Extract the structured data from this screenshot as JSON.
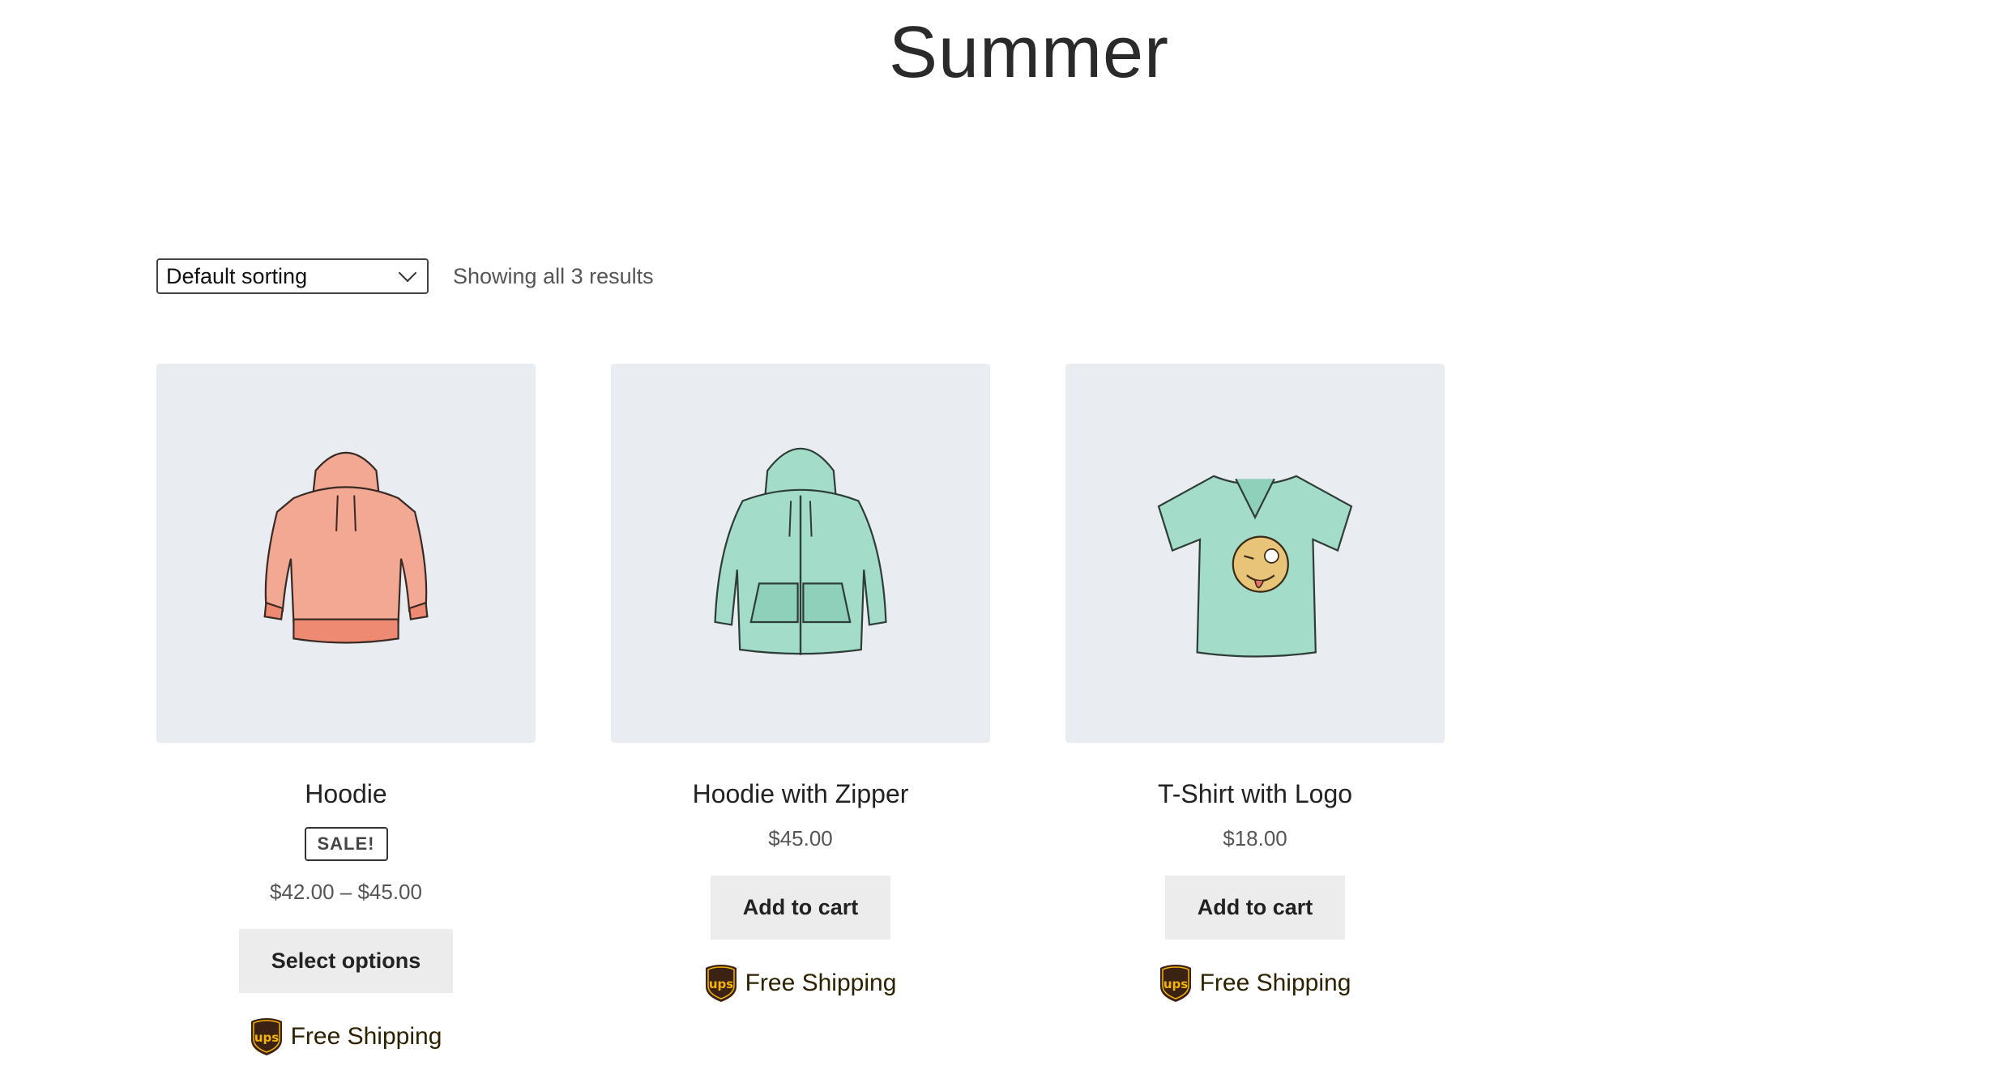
{
  "page": {
    "title": "Summer"
  },
  "toolbar": {
    "sort_selected": "Default sorting",
    "result_count": "Showing all 3 results"
  },
  "products": [
    {
      "name": "Hoodie",
      "badge": "SALE!",
      "price": "$42.00 – $45.00",
      "button": "Select options",
      "shipping": "Free Shipping",
      "image_color": "#f0a38e",
      "icon": "hoodie-image"
    },
    {
      "name": "Hoodie with Zipper",
      "price": "$45.00",
      "button": "Add to cart",
      "shipping": "Free Shipping",
      "image_color": "#9ed9c4",
      "icon": "zip-hoodie-image"
    },
    {
      "name": "T-Shirt with Logo",
      "price": "$18.00",
      "button": "Add to cart",
      "shipping": "Free Shipping",
      "image_color": "#9ed9c4",
      "icon": "tshirt-image"
    }
  ],
  "colors": {
    "thumb_bg": "#e9edf2",
    "button_bg": "#ececec",
    "ups_brown": "#3b2212",
    "ups_gold": "#f5b400"
  }
}
